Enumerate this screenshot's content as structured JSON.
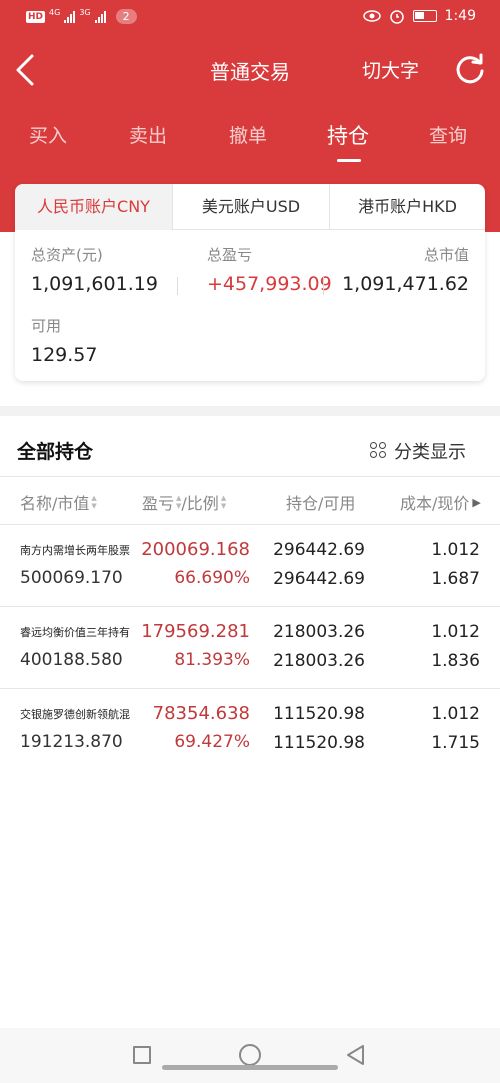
{
  "status_bar": {
    "hd": "HD",
    "net1": "4G",
    "net2": "3G",
    "notifications": "2",
    "time": "1:49"
  },
  "nav": {
    "title": "普通交易",
    "big_font_label": "切大字"
  },
  "tabs": [
    {
      "label": "买入"
    },
    {
      "label": "卖出"
    },
    {
      "label": "撤单"
    },
    {
      "label": "持仓"
    },
    {
      "label": "查询"
    }
  ],
  "account": {
    "currency_tabs": [
      {
        "label": "人民币账户CNY"
      },
      {
        "label": "美元账户USD"
      },
      {
        "label": "港币账户HKD"
      }
    ],
    "total_assets_label": "总资产(元)",
    "total_assets": "1,091,601.19",
    "total_pl_label": "总盈亏",
    "total_pl": "+457,993.09",
    "market_value_label": "总市值",
    "market_value": "1,091,471.62",
    "available_label": "可用",
    "available": "129.57"
  },
  "holdings": {
    "title": "全部持仓",
    "classify_label": "分类显示",
    "columns": {
      "name": "名称/市值",
      "pl": "盈亏",
      "ratio": "/比例",
      "position": "持仓/可用",
      "cost": "成本/现价"
    },
    "rows": [
      {
        "name": "南方内需增长两年股票",
        "market_value": "500069.170",
        "pl": "200069.168",
        "pl_pct": "66.690%",
        "position": "296442.69",
        "available": "296442.69",
        "cost": "1.012",
        "price": "1.687"
      },
      {
        "name": "睿远均衡价值三年持有",
        "market_value": "400188.580",
        "pl": "179569.281",
        "pl_pct": "81.393%",
        "position": "218003.26",
        "available": "218003.26",
        "cost": "1.012",
        "price": "1.836"
      },
      {
        "name": "交银施罗德创新领航混",
        "market_value": "191213.870",
        "pl": "78354.638",
        "pl_pct": "69.427%",
        "position": "111520.98",
        "available": "111520.98",
        "cost": "1.012",
        "price": "1.715"
      }
    ]
  },
  "colors": {
    "brand_red": "#d93a3b",
    "profit_red": "#c0393b"
  },
  "icons": [
    "back-icon",
    "refresh-icon",
    "grid-icon",
    "sort-icon",
    "eye-icon",
    "alarm-icon",
    "battery-icon"
  ]
}
